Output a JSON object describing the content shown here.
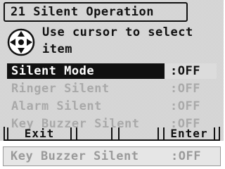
{
  "screen": {
    "title": "21 Silent Operation",
    "instruction_line_1": "Use cursor to select",
    "instruction_line_2": "item",
    "instruction_icon": "cursor-keys-icon"
  },
  "menu": {
    "items": [
      {
        "label": "Silent Mode",
        "value": ":OFF",
        "state": "selected"
      },
      {
        "label": "Ringer Silent",
        "value": ":OFF",
        "state": "disabled"
      },
      {
        "label": "Alarm Silent",
        "value": ":OFF",
        "state": "disabled"
      },
      {
        "label": "Key Buzzer Silent",
        "value": ":OFF",
        "state": "disabled"
      }
    ]
  },
  "softkeys": {
    "left": "Exit",
    "middle_1": "",
    "middle_2": "",
    "right": "Enter"
  },
  "preview_row": {
    "label": "Key Buzzer Silent",
    "value": ":OFF"
  },
  "colors": {
    "lcd_background": "#dcdcdc",
    "text": "#111111",
    "disabled_text": "#a9a9a9",
    "selection": "#111111"
  }
}
